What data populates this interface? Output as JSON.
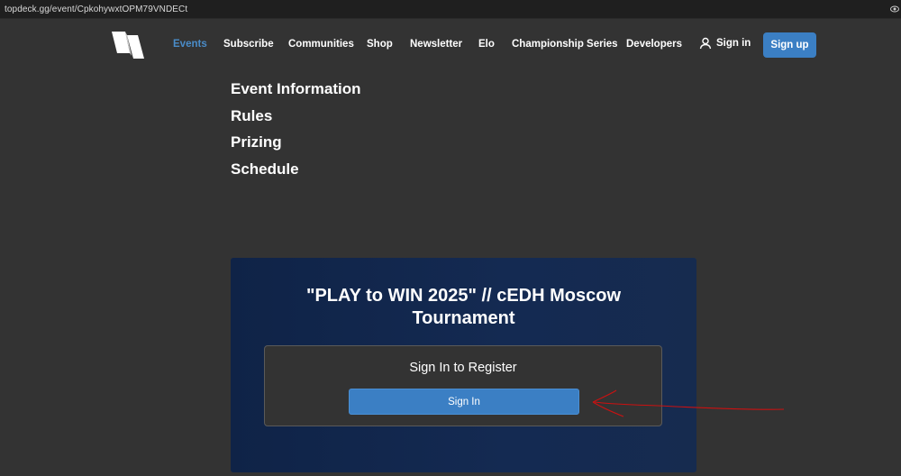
{
  "browser": {
    "url": "topdeck.gg/event/CpkohywxtOPM79VNDECt"
  },
  "nav": {
    "links": [
      "Events",
      "Subscribe",
      "Communities",
      "Shop",
      "Newsletter",
      "Elo",
      "Championship Series",
      "Developers"
    ],
    "active": "Events",
    "sign_in": "Sign in",
    "sign_up": "Sign up"
  },
  "sections": [
    "Event Information",
    "Rules",
    "Prizing",
    "Schedule"
  ],
  "event": {
    "title_line1": "\"PLAY to WIN 2025\" // cEDH Moscow",
    "title_line2": "Tournament",
    "register_heading": "Sign In to Register",
    "register_button": "Sign In"
  },
  "colors": {
    "background": "#333333",
    "accent": "#3b7fc4",
    "active_link": "#4a8cc8",
    "card": "#122750",
    "annotation": "#cc1111"
  }
}
